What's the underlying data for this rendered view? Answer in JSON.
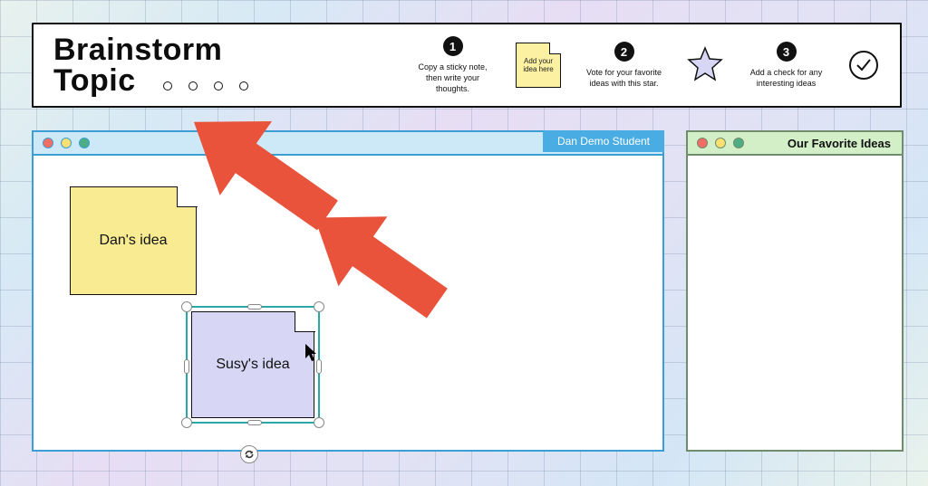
{
  "header": {
    "title_line1": "Brainstorm",
    "title_line2": "Topic",
    "dot_count": 4,
    "steps": [
      {
        "num": "1",
        "text": "Copy a sticky note, then write your thoughts."
      },
      {
        "sticky_text": "Add your idea here"
      },
      {
        "num": "2",
        "text": "Vote for your favorite ideas with this star."
      },
      {
        "star_fill": "#d7d6f4"
      },
      {
        "num": "3",
        "text": "Add a check for any interesting ideas"
      },
      {
        "check": true
      }
    ]
  },
  "main_window": {
    "owner_label": "Dan Demo Student",
    "sticky_yellow": {
      "text": "Dan's idea"
    },
    "sticky_purple": {
      "text": "Susy's idea",
      "selected": true
    }
  },
  "side_window": {
    "title": "Our Favorite Ideas"
  }
}
